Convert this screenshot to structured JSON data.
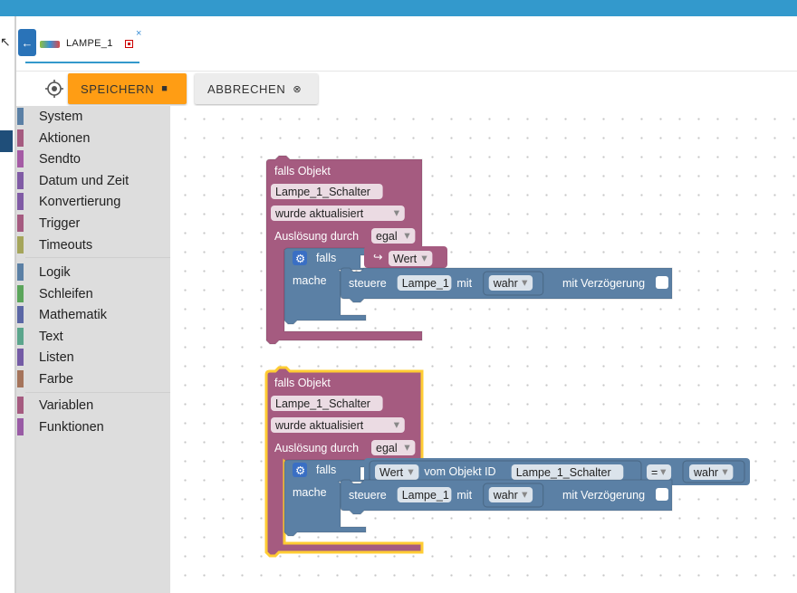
{
  "tab": {
    "title": "LAMPE_1",
    "close_glyph": "×"
  },
  "toolbar": {
    "save_label": "SPEICHERN",
    "cancel_label": "ABBRECHEN",
    "target_icon": "crosshair-icon",
    "save_icon": "floppy-disk-icon",
    "cancel_icon": "close-circle-icon"
  },
  "sidebar": {
    "groups": [
      [
        {
          "label": "System",
          "color": "#5b80a5"
        },
        {
          "label": "Aktionen",
          "color": "#a55b80"
        },
        {
          "label": "Sendto",
          "color": "#a55ba5"
        },
        {
          "label": "Datum und Zeit",
          "color": "#805ba5"
        },
        {
          "label": "Konvertierung",
          "color": "#805ba5"
        },
        {
          "label": "Trigger",
          "color": "#a55b80"
        },
        {
          "label": "Timeouts",
          "color": "#a5a55b"
        }
      ],
      [
        {
          "label": "Logik",
          "color": "#5b80a5"
        },
        {
          "label": "Schleifen",
          "color": "#5ba55b"
        },
        {
          "label": "Mathematik",
          "color": "#5b67a5"
        },
        {
          "label": "Text",
          "color": "#5ba58c"
        },
        {
          "label": "Listen",
          "color": "#745ba5"
        },
        {
          "label": "Farbe",
          "color": "#a5745b"
        }
      ],
      [
        {
          "label": "Variablen",
          "color": "#a55b80"
        },
        {
          "label": "Funktionen",
          "color": "#995ba5"
        }
      ]
    ]
  },
  "blocks": [
    {
      "header": "falls Objekt",
      "object": "Lampe_1_Schalter",
      "event": "wurde aktualisiert",
      "trigger_label": "Auslösung durch",
      "trigger_value": "egal",
      "if_label": "falls",
      "condition_arrow": "↪",
      "condition_field": "Wert",
      "do_label": "mache",
      "action_label": "steuere",
      "action_target": "Lampe_1",
      "with_label": "mit",
      "action_value": "wahr",
      "delay_label": "mit Verzögerung",
      "selected": false
    },
    {
      "header": "falls Objekt",
      "object": "Lampe_1_Schalter",
      "event": "wurde aktualisiert",
      "trigger_label": "Auslösung durch",
      "trigger_value": "egal",
      "if_label": "falls",
      "condition_field": "Wert",
      "condition_from": "vom Objekt ID",
      "condition_object": "Lampe_1_Schalter",
      "condition_op": "=",
      "condition_value": "wahr",
      "do_label": "mache",
      "action_label": "steuere",
      "action_target": "Lampe_1",
      "with_label": "mit",
      "action_value": "wahr",
      "delay_label": "mit Verzögerung",
      "selected": true
    }
  ],
  "colors": {
    "trigger_block": "#a55b80",
    "logic_block": "#5b80a5",
    "selected_outline": "#fc3",
    "toolbar_save": "#ff9d14",
    "topbar": "#3399cc"
  }
}
